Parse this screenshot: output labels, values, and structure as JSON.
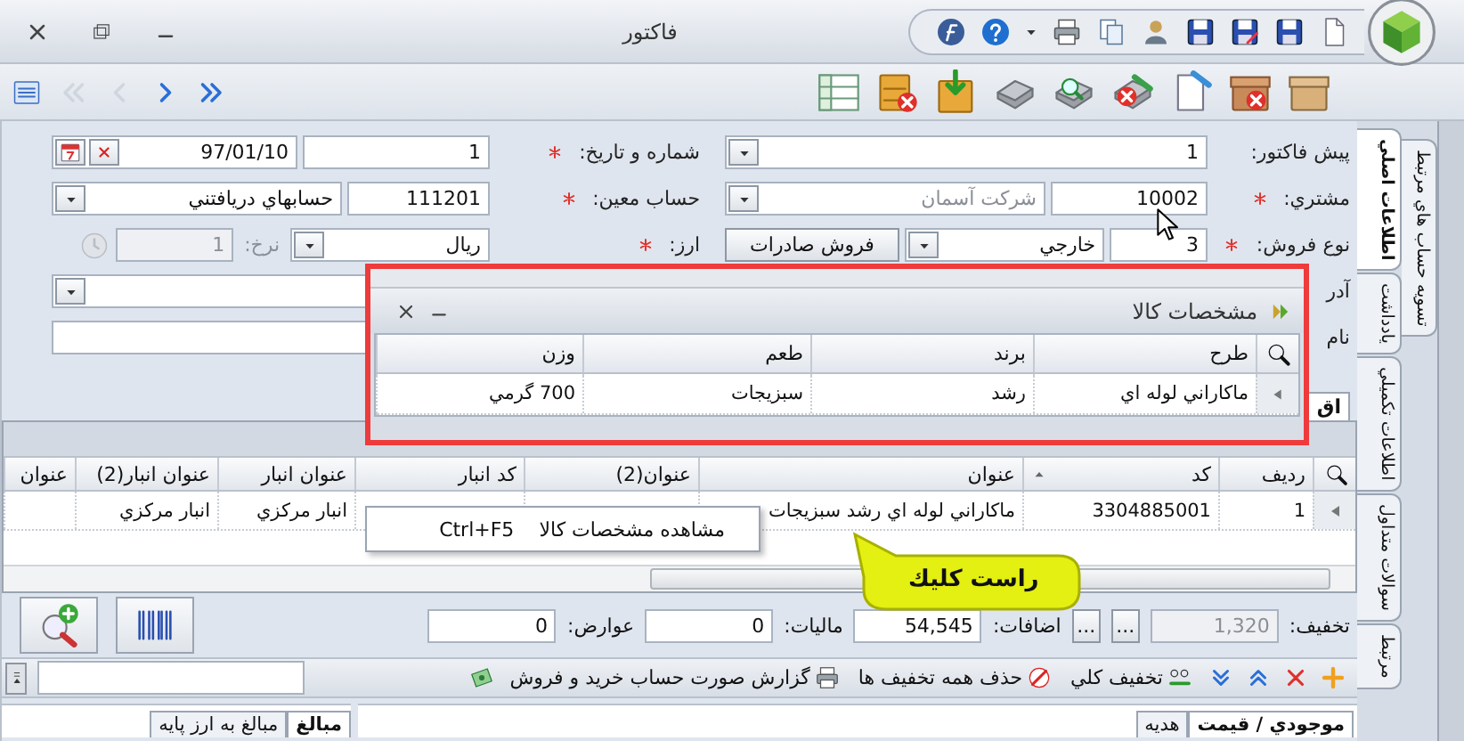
{
  "window": {
    "title": "فاكتور"
  },
  "nav_buttons": [
    {
      "kind": "list",
      "disabled": false
    },
    {
      "kind": "first",
      "disabled": true
    },
    {
      "kind": "previous",
      "disabled": true
    },
    {
      "kind": "next",
      "disabled": false
    },
    {
      "kind": "last",
      "disabled": false
    }
  ],
  "form": {
    "pre_invoice": {
      "label": "پيش فاكتور:",
      "required": false,
      "value": "1"
    },
    "customer": {
      "label": "مشتري:",
      "required": true,
      "code": "10002",
      "name": "شركت آسمان",
      "name_disabled": true
    },
    "sale_type": {
      "label": "نوع فروش:",
      "required": true,
      "code": "3",
      "name": "خارجي",
      "button": "فروش صادرات"
    },
    "address": {
      "label": "آدر"
    },
    "name": {
      "label": "نام"
    },
    "number_date": {
      "label": "شماره و تاريخ:",
      "required": true,
      "number": "1",
      "date": "97/01/10"
    },
    "account": {
      "label": "حساب معين:",
      "required": true,
      "code": "111201",
      "name": "حسابهاي دريافتني"
    },
    "currency": {
      "label": "ارز:",
      "required": true,
      "value": "ريال",
      "rate_label": "نرخ:",
      "rate": "1",
      "rate_disabled": true
    }
  },
  "items_tabs": [
    {
      "label": "اق",
      "selected": true
    }
  ],
  "items_table": {
    "columns": [
      {
        "label": "رديف",
        "sorted": false
      },
      {
        "label": "كد",
        "sorted": true
      },
      {
        "label": "عنوان",
        "sorted": false
      },
      {
        "label": "عنوان(2)",
        "sorted": false
      },
      {
        "label": "كد انبار",
        "sorted": false
      },
      {
        "label": "عنوان انبار",
        "sorted": false
      },
      {
        "label": "عنوان انبار(2)",
        "sorted": false
      },
      {
        "label": "عنوان",
        "sorted": false
      }
    ],
    "rows": [
      {
        "current": true,
        "cells": [
          "1",
          "3304885001",
          "ماكاراني لوله اي رشد سبزيجات",
          "",
          "",
          "انبار مركزي",
          "انبار مركزي",
          ""
        ]
      }
    ]
  },
  "totals": [
    {
      "kind": "field",
      "label": "تخفيف:",
      "value": "1,320",
      "disabled": true
    },
    {
      "kind": "button",
      "text": "..."
    },
    {
      "kind": "button",
      "text": "..."
    },
    {
      "kind": "field",
      "label": "اضافات:",
      "value": "54,545",
      "disabled": false
    },
    {
      "kind": "field",
      "label": "ماليات:",
      "value": "0",
      "disabled": false
    },
    {
      "kind": "field",
      "label": "عوارض:",
      "value": "0",
      "disabled": false
    }
  ],
  "bottom_toolbar": [
    {
      "kind": "add"
    },
    {
      "kind": "delete"
    },
    {
      "kind": "move_up"
    },
    {
      "kind": "move_down"
    },
    {
      "kind": "discount",
      "label": "تخفيف كلي"
    },
    {
      "kind": "remove_discounts",
      "label": "حذف همه تخفيف ها"
    },
    {
      "kind": "report",
      "label": "گزارش صورت حساب خريد و فروش"
    },
    {
      "kind": "money"
    }
  ],
  "detail_tabs": [
    {
      "label": "موجودي / قيمت",
      "selected": true
    },
    {
      "label": "هديه",
      "selected": false
    }
  ],
  "amount_tabs": [
    {
      "label": "مبالغ",
      "selected": true
    },
    {
      "label": "مبالغ به ارز پايه",
      "selected": false
    }
  ],
  "side_tabs": [
    {
      "label": "اطلاعات اصلي",
      "selected": true
    },
    {
      "label": "يادداشت",
      "selected": false
    },
    {
      "label": "اطلاعات تكميلي",
      "selected": false
    },
    {
      "label": "سوالات متداول",
      "selected": false
    },
    {
      "label": "مرتبط",
      "selected": false
    }
  ],
  "outer_side_tabs": [
    {
      "label": "تسويه حساب هاي مرتبط",
      "selected": false
    }
  ],
  "popup": {
    "title": "مشخصات كالا",
    "columns": [
      "طرح",
      "برند",
      "طعم",
      "وزن"
    ],
    "rows": [
      [
        "ماكاراني لوله اي",
        "رشد",
        "سبزيجات",
        "700 گرمي"
      ]
    ]
  },
  "context_menu": [
    {
      "label": "مشاهده مشخصات كالا",
      "shortcut": "Ctrl+F5"
    }
  ],
  "callout": {
    "text": "راست كليك"
  }
}
